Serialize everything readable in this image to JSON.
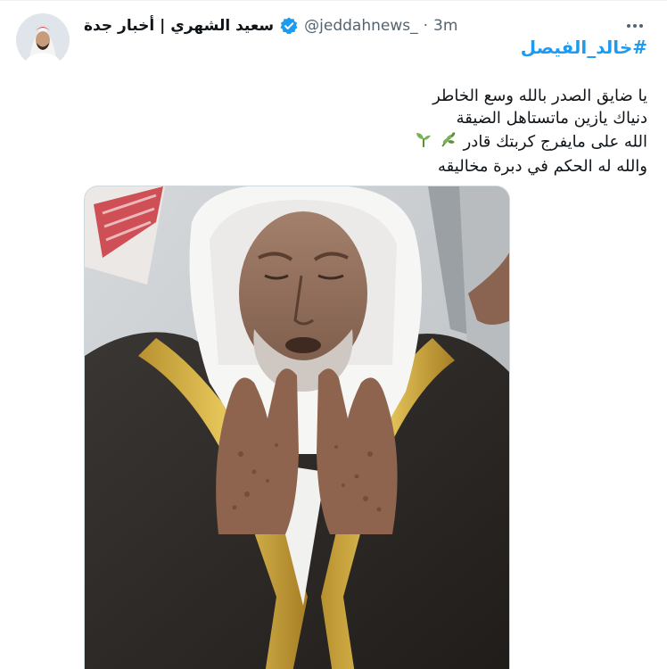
{
  "author": {
    "display_name": "سعيد الشهري | أخبار جدة",
    "handle": "@jeddahnews_",
    "separator": "·",
    "time": "3m",
    "verified": true,
    "avatar_icon": "user-avatar"
  },
  "tweet": {
    "hashtag": "#خالد_الفيصل",
    "lines": [
      "يا ضايق الصدر بالله وسع الخاطر",
      "دنياك يازين ماتستاهل الضيقة",
      "الله على مايفرج كربتك قادر",
      "والله له الحكم في دبرة مخاليقه"
    ],
    "emojis": [
      "herb-emoji",
      "seedling-emoji"
    ]
  },
  "media": {
    "type": "photo",
    "subject": "photo-praying-elder"
  },
  "colors": {
    "accent": "#1d9bf0",
    "text": "#0f1419",
    "secondary": "#536471",
    "verified": "#1d9bf0"
  },
  "icons": {
    "more": "more-horizontal-icon",
    "verified": "verified-badge-icon"
  }
}
